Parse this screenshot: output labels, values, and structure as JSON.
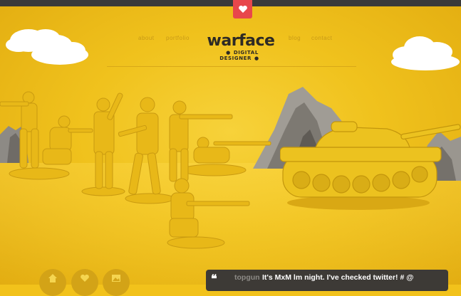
{
  "header": {
    "nav_left": [
      "about",
      "portfolio"
    ],
    "nav_right": [
      "blog",
      "contact"
    ],
    "logo": {
      "name": "warface",
      "tagline": "DIGITAL DESIGNER"
    },
    "heart_icon": "heart-icon",
    "heart_color": "#e8474b"
  },
  "scene": {
    "background_color": "#f2c21b",
    "elements": [
      "clouds",
      "rocks",
      "toy-soldiers",
      "toy-tank"
    ]
  },
  "social": {
    "icons": [
      "home-icon",
      "heart-icon",
      "image-icon"
    ]
  },
  "tweet": {
    "user": "topgun",
    "text": "It's MxM lm night. I've checked twitter! # @"
  }
}
